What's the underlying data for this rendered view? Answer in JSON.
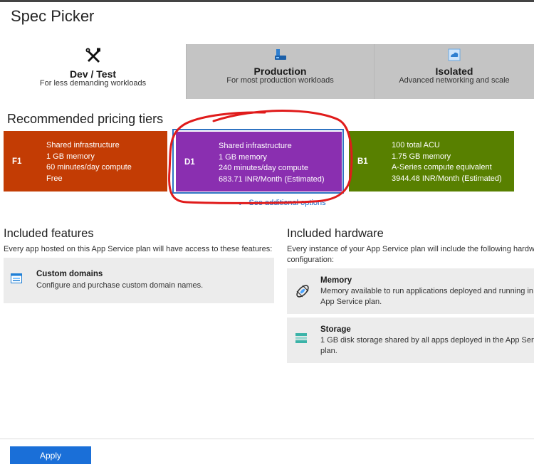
{
  "title": "Spec Picker",
  "tabs": [
    {
      "name": "Dev / Test",
      "sub": "For less demanding workloads",
      "icon": "tools-icon",
      "active": true
    },
    {
      "name": "Production",
      "sub": "For most production workloads",
      "icon": "app-service-icon",
      "active": false
    },
    {
      "name": "Isolated",
      "sub": "Advanced networking and scale",
      "icon": "isolated-environment-icon",
      "active": false
    }
  ],
  "recommended_heading": "Recommended pricing tiers",
  "tiers": [
    {
      "code": "F1",
      "color": "#c33c04",
      "lines": [
        "Shared infrastructure",
        "1 GB memory",
        "60 minutes/day compute",
        "Free"
      ]
    },
    {
      "code": "D1",
      "color": "#8a2fb0",
      "selected": true,
      "lines": [
        "Shared infrastructure",
        "1 GB memory",
        "240 minutes/day compute",
        "683.71 INR/Month (Estimated)"
      ]
    },
    {
      "code": "B1",
      "color": "#588000",
      "lines": [
        "100 total ACU",
        "1.75 GB memory",
        "A-Series compute equivalent",
        "3944.48 INR/Month (Estimated)"
      ]
    }
  ],
  "see_more": "See additional options",
  "features": {
    "heading": "Included features",
    "desc": "Every app hosted on this App Service plan will have access to these features:",
    "items": [
      {
        "title": "Custom domains",
        "desc": "Configure and purchase custom domain names.",
        "icon": "custom-domains-icon"
      }
    ]
  },
  "hardware": {
    "heading": "Included hardware",
    "desc_line1": "Every instance of your App Service plan will include the following hardw",
    "desc_line2": "configuration:",
    "items": [
      {
        "title": "Memory",
        "desc_line1": "Memory available to run applications deployed and running in",
        "desc_line2": "App Service plan.",
        "icon": "memory-icon"
      },
      {
        "title": "Storage",
        "desc_line1": "1 GB disk storage shared by all apps deployed in the App Serv",
        "desc_line2": "plan.",
        "icon": "storage-icon"
      }
    ]
  },
  "apply_label": "Apply",
  "colors": {
    "accent": "#1a6fd8",
    "annotation": "#e01b1b"
  }
}
